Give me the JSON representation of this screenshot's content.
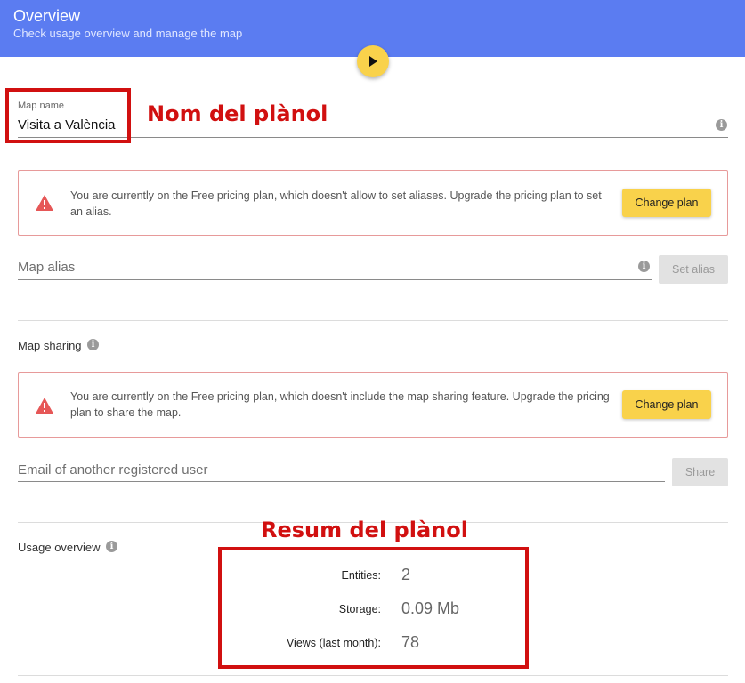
{
  "header": {
    "title": "Overview",
    "subtitle": "Check usage overview and manage the map",
    "color": "#5b7cf1"
  },
  "play_button": {
    "icon": "play-icon",
    "color": "#f9d24b"
  },
  "map_name": {
    "label": "Map name",
    "value": "Visita a València"
  },
  "alias_alert": {
    "icon": "warning-icon",
    "message": "You are currently on the Free pricing plan, which doesn't allow to set aliases. Upgrade the pricing plan to set an alias.",
    "button_label": "Change plan"
  },
  "map_alias": {
    "placeholder": "Map alias",
    "button_label": "Set alias"
  },
  "map_sharing": {
    "title": "Map sharing",
    "alert_message": "You are currently on the Free pricing plan, which doesn't include the map sharing feature. Upgrade the pricing plan to share the map.",
    "alert_button_label": "Change plan",
    "email_placeholder": "Email of another registered user",
    "share_button_label": "Share"
  },
  "usage_overview": {
    "title": "Usage overview",
    "stats": [
      {
        "label": "Entities:",
        "value": "2"
      },
      {
        "label": "Storage:",
        "value": "0.09 Mb"
      },
      {
        "label": "Views (last month):",
        "value": "78"
      }
    ]
  },
  "annotations": {
    "map_name_label": "Nom del plànol",
    "summary_label": "Resum del plànol",
    "color": "#d11010"
  }
}
